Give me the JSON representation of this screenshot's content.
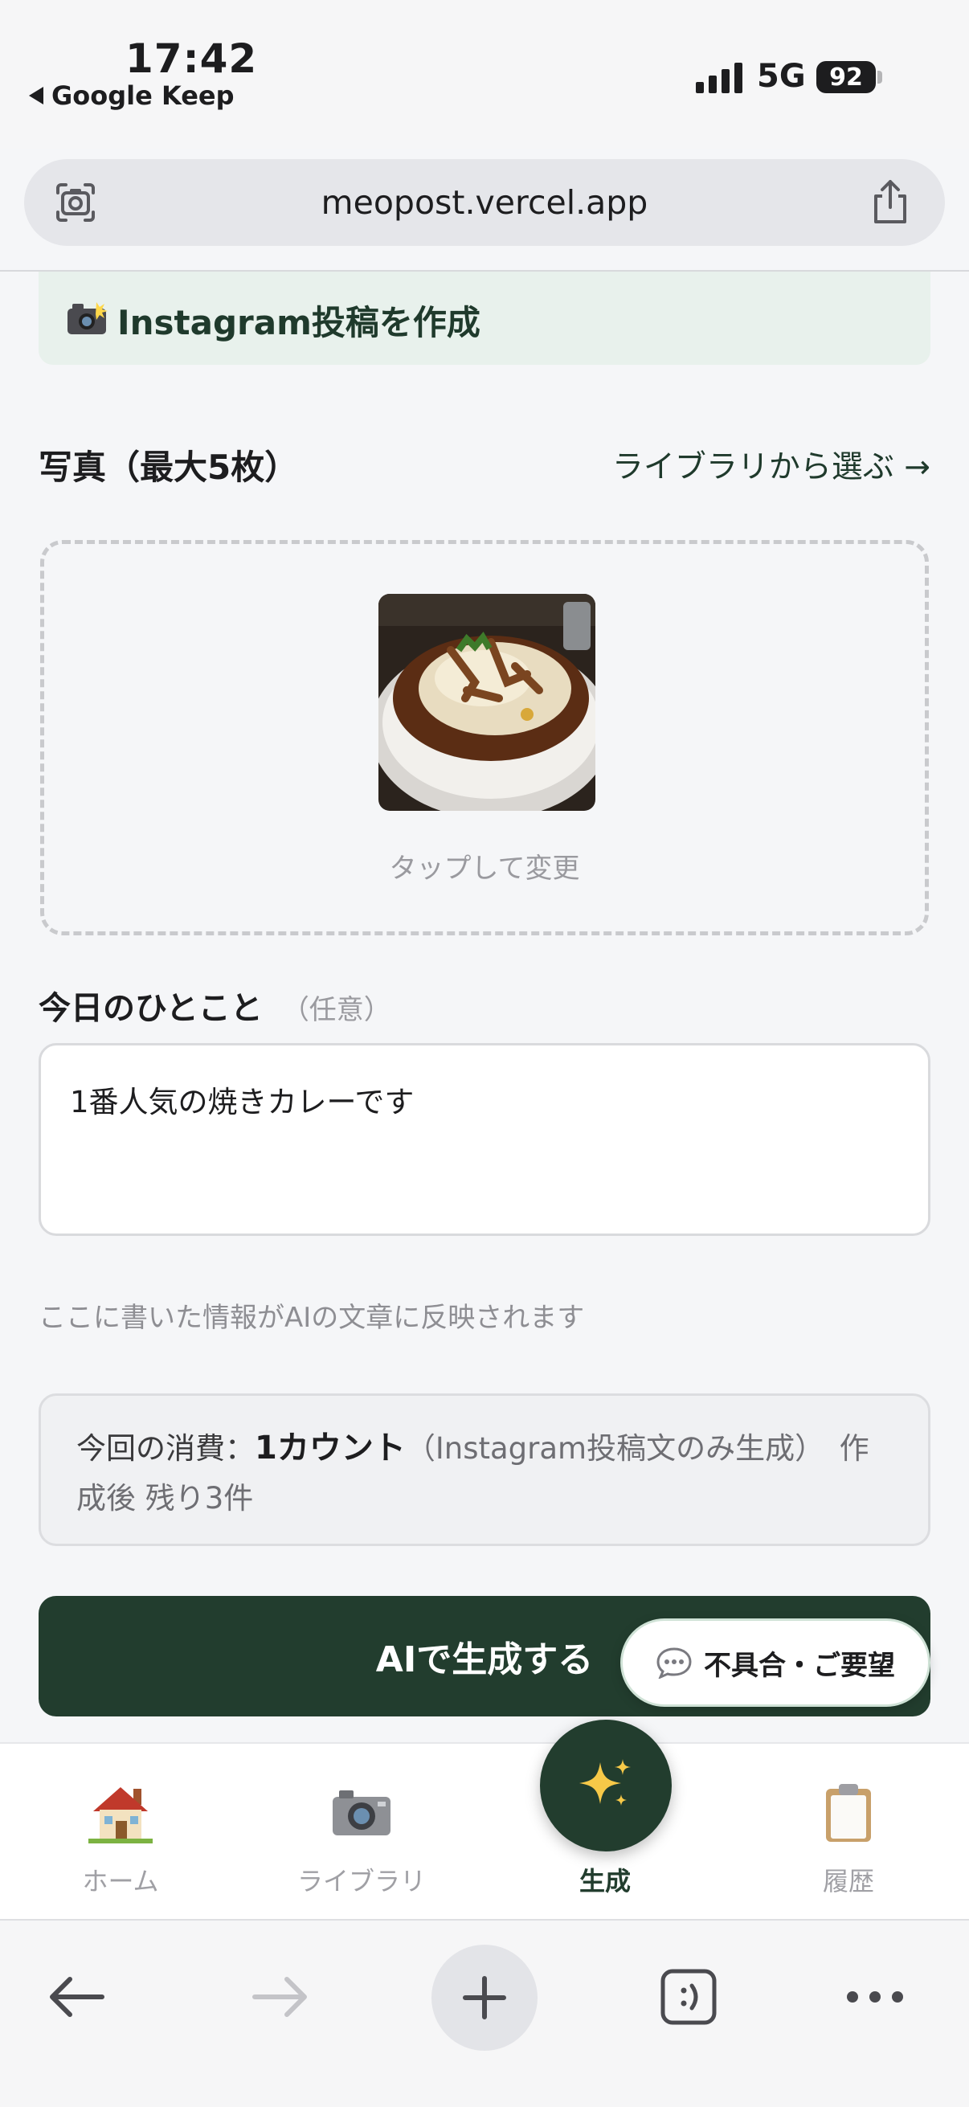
{
  "status_bar": {
    "time": "17:42",
    "back_app": "Google Keep",
    "network": "5G",
    "battery": "92"
  },
  "browser": {
    "url": "meopost.vercel.app"
  },
  "page": {
    "banner_title": "Instagram投稿を作成",
    "photos": {
      "title": "写真（最大5枚）",
      "library_link": "ライブラリから選ぶ →",
      "tap_to_change": "タップして変更"
    },
    "comment": {
      "label": "今日のひとこと",
      "optional": "（任意）",
      "value": "1番人気の焼きカレーです",
      "hint": "ここに書いた情報がAIの文章に反映されます"
    },
    "cost": {
      "label": "今回の消費：",
      "amount": "1カウント",
      "detail": "（Instagram投稿文のみ生成）",
      "remaining": "作成後 残り3件"
    },
    "generate_button": "AIで生成する",
    "feedback_button": "不具合・ご要望"
  },
  "tab_bar": {
    "tabs": [
      {
        "label": "ホーム",
        "icon": "house-icon"
      },
      {
        "label": "ライブラリ",
        "icon": "camera-icon"
      },
      {
        "label": "生成",
        "icon": "sparkles-icon"
      },
      {
        "label": "履歴",
        "icon": "clipboard-icon"
      }
    ],
    "active_index": 2
  },
  "colors": {
    "brand_green": "#223d2e",
    "banner_bg": "#e8f1ec"
  }
}
